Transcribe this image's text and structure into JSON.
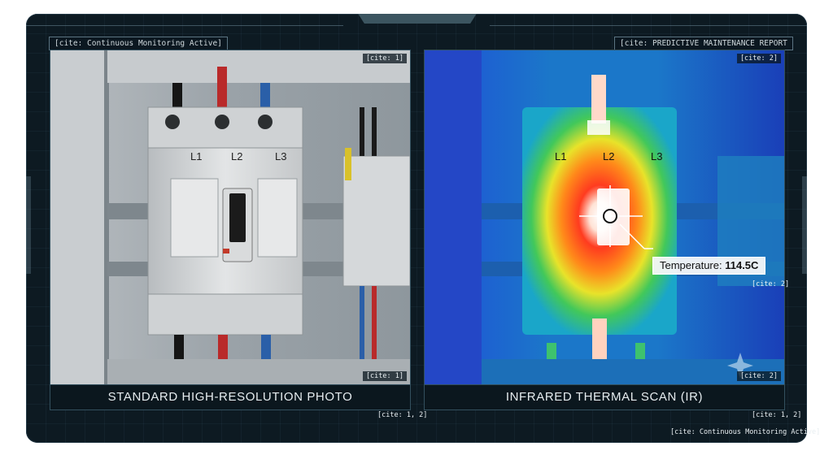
{
  "header": {
    "left_tag": "[cite: Continuous Monitoring Active]",
    "right_tag": "[cite: PREDICTIVE MAINTENANCE REPORT"
  },
  "left_panel": {
    "corner_cite": "[cite: 1]",
    "bottom_cite": "[cite: 1]",
    "caption": "STANDARD HIGH-RESOLUTION PHOTO",
    "caption_cite": "[cite: 1, 2]",
    "phase_labels": [
      "L1",
      "L2",
      "L3"
    ]
  },
  "right_panel": {
    "corner_cite": "[cite: 2]",
    "bottom_cite": "[cite: 2]",
    "caption": "INFRARED THERMAL SCAN (IR)",
    "caption_cite": "[cite: 1, 2]",
    "phase_labels": [
      "L1",
      "L2",
      "L3"
    ],
    "temperature_label": "Temperature:",
    "temperature_value": "114.5C",
    "temperature_cite": "[cite: 2]"
  },
  "footer": {
    "cite": "[cite: Continuous Monitoring Active]"
  },
  "colors": {
    "background": "#0d1a22",
    "hot": "#ffffff",
    "warm": "#ff3b1f",
    "cool": "#1f4fd8"
  }
}
